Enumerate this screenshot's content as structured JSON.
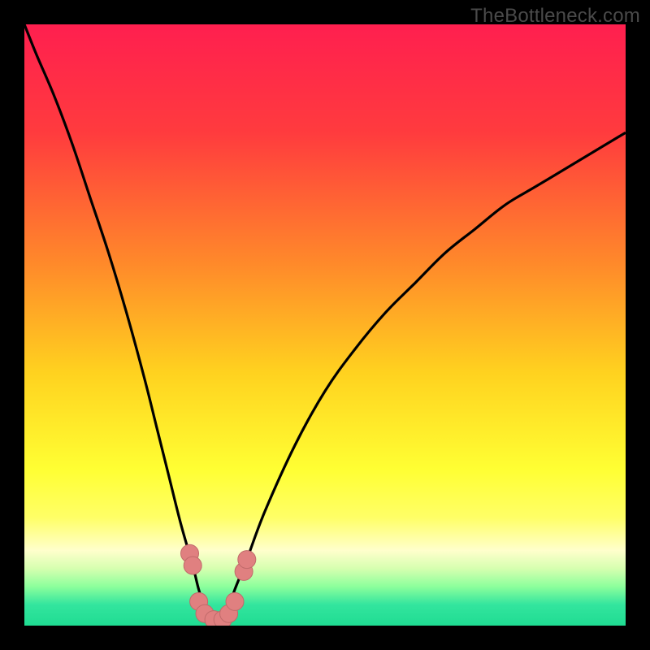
{
  "watermark": "TheBottleneck.com",
  "colors": {
    "frame": "#000000",
    "gradient_stops": [
      {
        "offset": 0.0,
        "color": "#ff1f4f"
      },
      {
        "offset": 0.18,
        "color": "#ff3b3e"
      },
      {
        "offset": 0.4,
        "color": "#ff8a2a"
      },
      {
        "offset": 0.58,
        "color": "#ffd21f"
      },
      {
        "offset": 0.74,
        "color": "#ffff33"
      },
      {
        "offset": 0.82,
        "color": "#ffff66"
      },
      {
        "offset": 0.875,
        "color": "#ffffcc"
      },
      {
        "offset": 0.905,
        "color": "#d6ffb0"
      },
      {
        "offset": 0.935,
        "color": "#8cff9c"
      },
      {
        "offset": 0.965,
        "color": "#33e59e"
      },
      {
        "offset": 1.0,
        "color": "#1fdc92"
      }
    ],
    "curve": "#000000",
    "marker_fill": "#e08080",
    "marker_stroke": "#c06a6a"
  },
  "chart_data": {
    "type": "line",
    "title": "",
    "xlabel": "",
    "ylabel": "",
    "xlim": [
      0,
      100
    ],
    "ylim": [
      0,
      100
    ],
    "series": [
      {
        "name": "main-curve",
        "x": [
          0,
          2,
          5,
          8,
          11,
          14,
          17,
          20,
          22,
          24,
          26,
          28,
          29,
          30,
          31,
          32,
          33,
          34,
          35,
          37,
          40,
          45,
          50,
          55,
          60,
          65,
          70,
          75,
          80,
          85,
          90,
          95,
          100
        ],
        "y": [
          100,
          95,
          88,
          80,
          71,
          62,
          52,
          41,
          33,
          25,
          17,
          10,
          6,
          3,
          1,
          0,
          1,
          3,
          6,
          11,
          19,
          30,
          39,
          46,
          52,
          57,
          62,
          66,
          70,
          73,
          76,
          79,
          82
        ]
      }
    ],
    "markers": [
      {
        "x": 27.5,
        "y": 12
      },
      {
        "x": 28.0,
        "y": 10
      },
      {
        "x": 29.0,
        "y": 4
      },
      {
        "x": 30.0,
        "y": 2
      },
      {
        "x": 31.5,
        "y": 1
      },
      {
        "x": 33.0,
        "y": 1
      },
      {
        "x": 34.0,
        "y": 2
      },
      {
        "x": 35.0,
        "y": 4
      },
      {
        "x": 36.5,
        "y": 9
      },
      {
        "x": 37.0,
        "y": 11
      }
    ]
  }
}
